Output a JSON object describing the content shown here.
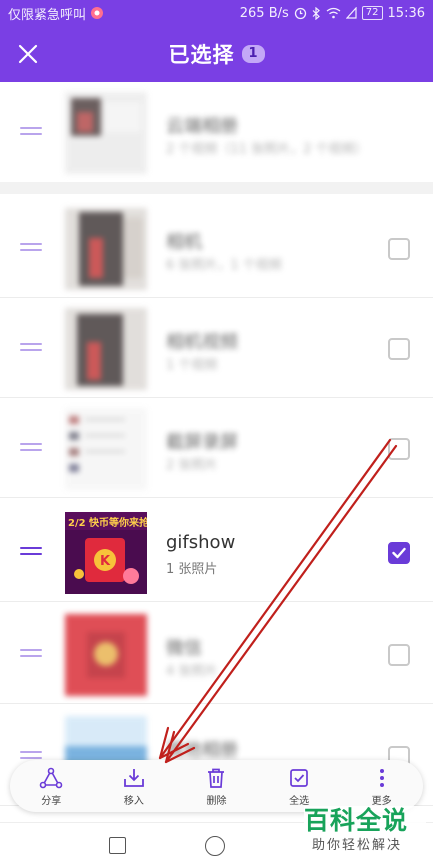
{
  "status_bar": {
    "left_text": "仅限紧急呼叫",
    "speed": "265 B/s",
    "battery": "72",
    "time": "15:36"
  },
  "header": {
    "title": "已选择",
    "count": "1",
    "close_icon": "close-icon"
  },
  "albums": [
    {
      "name": "云端相册",
      "sub": "2 个视频（11 张照片，2 个视频）",
      "blurred": true,
      "checked": false
    },
    {
      "name": "相机",
      "sub": "6 张照片，1 个视频",
      "blurred": true,
      "checked": false
    },
    {
      "name": "相机视频",
      "sub": "1 个视频",
      "blurred": true,
      "checked": false
    },
    {
      "name": "截屏录屏",
      "sub": "2 张照片",
      "blurred": true,
      "checked": false
    },
    {
      "name": "gifshow",
      "sub": "1 张照片",
      "blurred": false,
      "checked": true
    },
    {
      "name": "微信",
      "sub": "4 张照片",
      "blurred": true,
      "checked": false
    },
    {
      "name": "其他相册",
      "sub": "",
      "blurred": true,
      "checked": false
    }
  ],
  "thumbnail_text": {
    "banner": "2/2 快币等你来抢",
    "coin_letter": "K"
  },
  "toolbar": {
    "share": "分享",
    "move_in": "移入",
    "delete": "删除",
    "select_all": "全选",
    "more": "更多"
  },
  "watermark": {
    "main": "百科全说",
    "sub": "助你轻松解决"
  },
  "colors": {
    "accent": "#7a3fe4",
    "check": "#6a3bd8",
    "arrow": "#c0201c"
  }
}
